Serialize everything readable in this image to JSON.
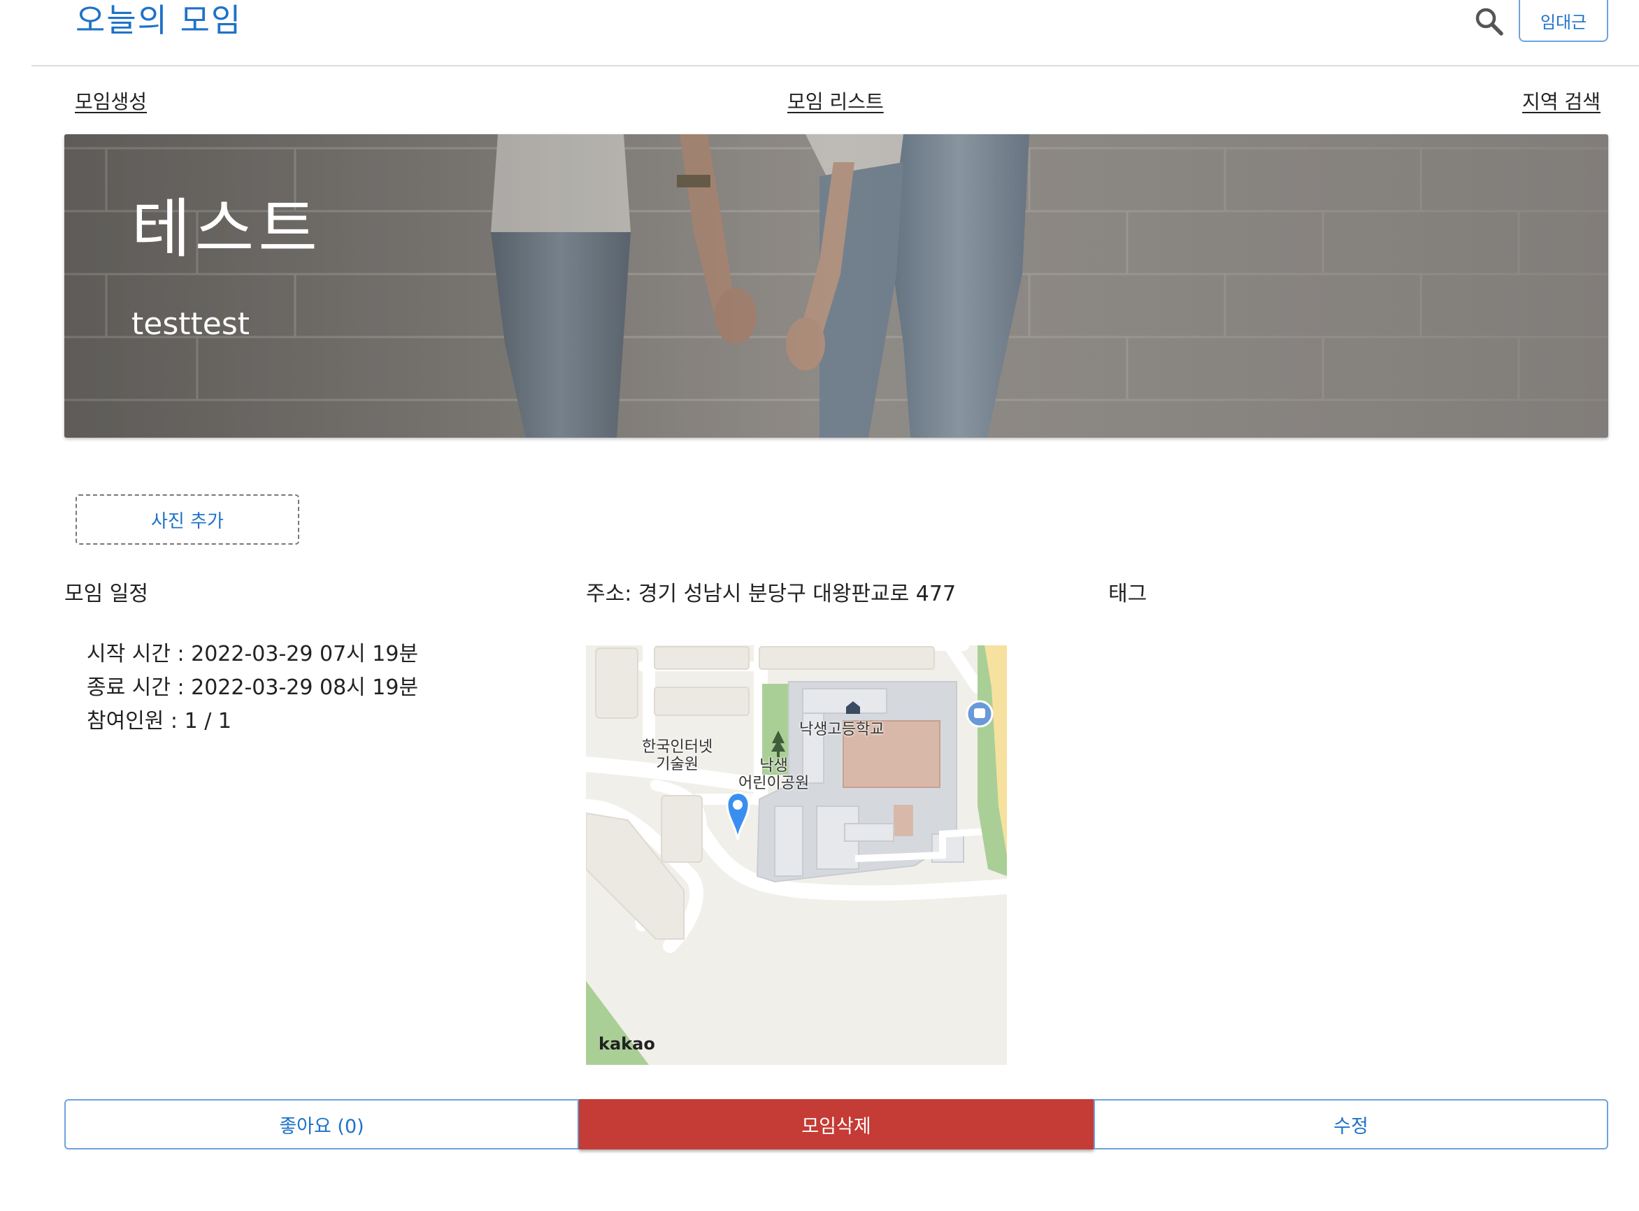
{
  "header": {
    "brand": "오늘의 모임",
    "user_button": "임대근",
    "search_icon": "search-icon"
  },
  "nav": {
    "create": "모임생성",
    "list": "모임 리스트",
    "region_search": "지역 검색"
  },
  "hero": {
    "title": "테스트",
    "subtitle": "testtest"
  },
  "add_photo_label": "사진 추가",
  "schedule": {
    "heading": "모임 일정",
    "start": "시작 시간 : 2022-03-29 07시 19분",
    "end": "종료 시간 : 2022-03-29 08시 19분",
    "participants": "참여인원 : 1 / 1"
  },
  "address": {
    "label": "주소: 경기 성남시 분당구 대왕판교로 477"
  },
  "tags": {
    "heading": "태그"
  },
  "map": {
    "labels": {
      "institute": "한국인터넷\n기술원",
      "park": "낙생\n어린이공원",
      "school": "낙생고등학교"
    },
    "logo": "kakao"
  },
  "actions": {
    "like": "좋아요 (0)",
    "delete": "모임삭제",
    "edit": "수정"
  },
  "colors": {
    "accent": "#1f72c8",
    "danger": "#c53b35"
  }
}
